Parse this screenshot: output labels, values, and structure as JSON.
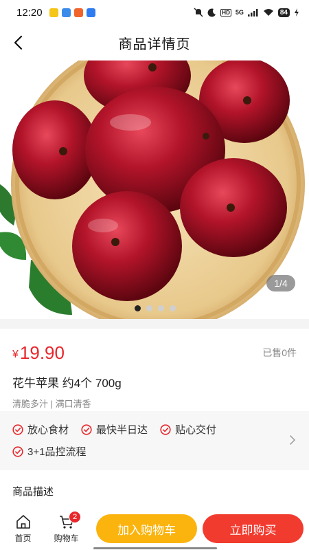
{
  "status_bar": {
    "time": "12:20",
    "battery": "84",
    "network": "5G"
  },
  "nav": {
    "title": "商品详情页"
  },
  "gallery": {
    "counter": "1/4",
    "dots_total": 4,
    "active_index": 0
  },
  "product": {
    "currency_symbol": "¥",
    "price": "19.90",
    "sold": "已售0件",
    "name": "花牛苹果 约4个 700g",
    "tags": "清脆多汁 | 满口清香"
  },
  "guarantees": [
    "放心食材",
    "最快半日达",
    "贴心交付",
    "3+1品控流程"
  ],
  "description": {
    "title": "商品描述"
  },
  "bottom_bar": {
    "home_label": "首页",
    "cart_label": "购物车",
    "cart_count": "2",
    "add_to_cart": "加入购物车",
    "buy_now": "立即购买"
  },
  "colors": {
    "price": "#e8262b",
    "add_to_cart": "#fbb40e",
    "buy_now": "#f23b2f"
  }
}
